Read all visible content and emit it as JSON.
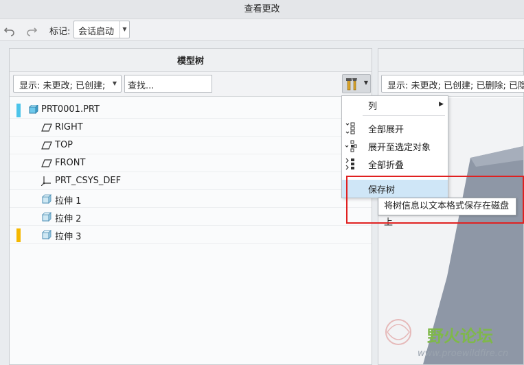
{
  "window": {
    "title": "查看更改"
  },
  "toolbar": {
    "undo_icon": "undo-icon",
    "redo_icon": "redo-icon",
    "marker_label": "标记:",
    "marker_value": "会话启动"
  },
  "left_pane": {
    "title": "模型树",
    "filter_value": "显示: 未更改; 已创建;",
    "search_placeholder": "查找...",
    "tree": [
      {
        "label": "PRT0001.PRT",
        "icon": "part-icon",
        "marker": "#4cc4ea"
      },
      {
        "label": "RIGHT",
        "icon": "datum-plane-icon"
      },
      {
        "label": "TOP",
        "icon": "datum-plane-icon"
      },
      {
        "label": "FRONT",
        "icon": "datum-plane-icon"
      },
      {
        "label": "PRT_CSYS_DEF",
        "icon": "coordinate-system-icon"
      },
      {
        "label": "拉伸 1",
        "icon": "extrude-icon"
      },
      {
        "label": "拉伸 2",
        "icon": "extrude-icon"
      },
      {
        "label": "拉伸 3",
        "icon": "extrude-icon",
        "marker": "#f5b800"
      }
    ]
  },
  "right_pane": {
    "filter_value": "显示: 未更改; 已创建; 已删除; 已隐"
  },
  "settings_menu": {
    "items": [
      {
        "label": "列",
        "icon": "",
        "submenu": true
      },
      {
        "label": "全部展开",
        "icon": "expand-all-icon"
      },
      {
        "label": "展开至选定对象",
        "icon": "expand-to-selected-icon"
      },
      {
        "label": "全部折叠",
        "icon": "collapse-all-icon"
      },
      {
        "label": "保存树",
        "icon": "",
        "highlighted": true
      }
    ]
  },
  "tooltip": {
    "text": "将树信息以文本格式保存在磁盘上"
  },
  "watermark": {
    "title": "野火论坛",
    "url": "www.proewildfire.cn"
  },
  "colors": {
    "highlight": "#cfe6f7",
    "annotation_box": "#e02020",
    "new_marker": "#4cc4ea",
    "changed_marker": "#f5b800"
  }
}
